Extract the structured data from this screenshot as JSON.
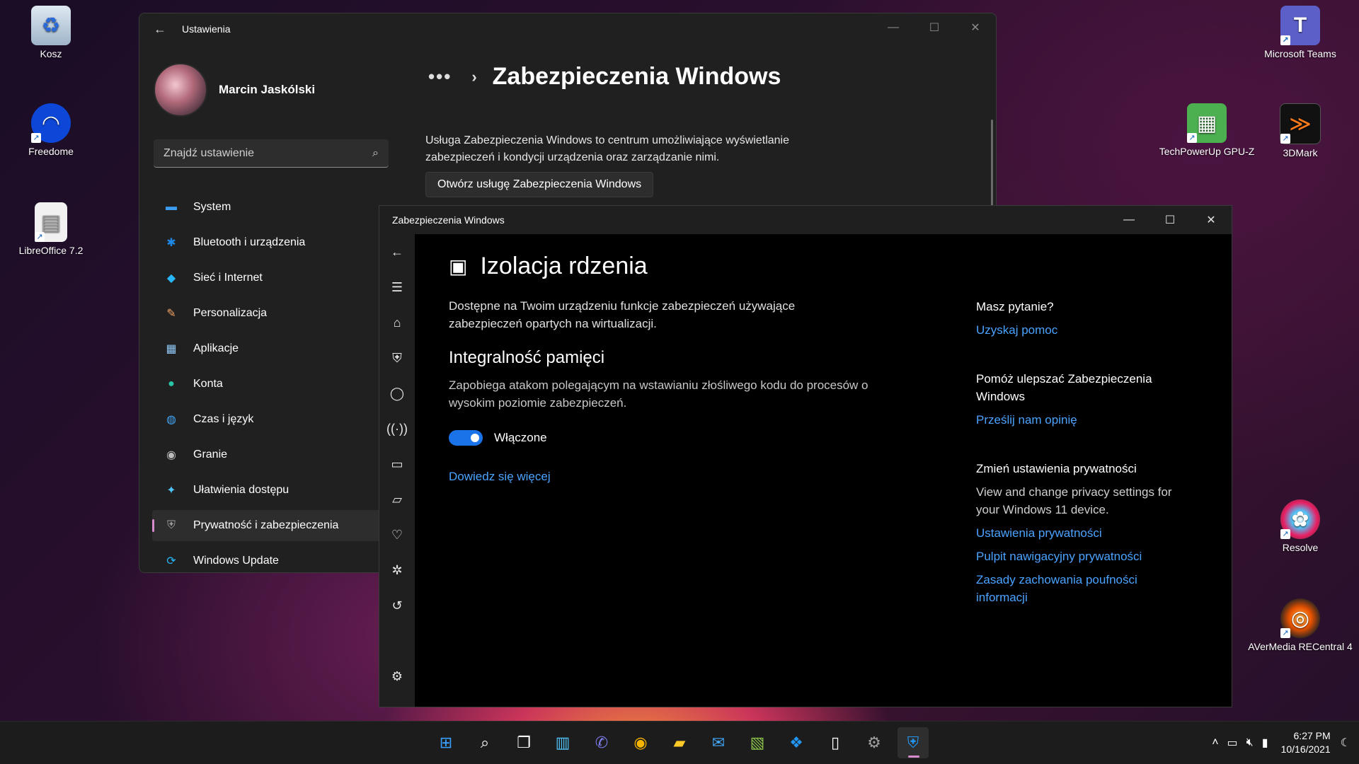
{
  "desktop": {
    "icons": [
      {
        "label": "Kosz",
        "icon": "recycle-bin-icon"
      },
      {
        "label": "Freedome",
        "icon": "freedome-icon"
      },
      {
        "label": "LibreOffice 7.2",
        "icon": "document-icon"
      },
      {
        "label": "Microsoft Teams",
        "icon": "teams-icon"
      },
      {
        "label": "TechPowerUp GPU-Z",
        "icon": "gpu-z-icon"
      },
      {
        "label": "3DMark",
        "icon": "3dmark-icon"
      },
      {
        "label": "Resolve",
        "icon": "resolve-icon"
      },
      {
        "label": "AVerMedia RECentral 4",
        "icon": "recentral-icon"
      }
    ]
  },
  "settings": {
    "title": "Ustawienia",
    "user_name": "Marcin Jaskólski",
    "search_placeholder": "Znajdź ustawienie",
    "nav": [
      {
        "label": "System",
        "icon": "monitor-icon",
        "color": "#3b9cf0"
      },
      {
        "label": "Bluetooth i urządzenia",
        "icon": "bluetooth-icon",
        "color": "#1e88e5"
      },
      {
        "label": "Sieć i Internet",
        "icon": "wifi-icon",
        "color": "#29b6f6"
      },
      {
        "label": "Personalizacja",
        "icon": "brush-icon",
        "color": "#f4a261"
      },
      {
        "label": "Aplikacje",
        "icon": "apps-icon",
        "color": "#90caf9"
      },
      {
        "label": "Konta",
        "icon": "person-icon",
        "color": "#26c6a6"
      },
      {
        "label": "Czas i język",
        "icon": "globe-icon",
        "color": "#42a5f5"
      },
      {
        "label": "Granie",
        "icon": "gamepad-icon",
        "color": "#bdbdbd"
      },
      {
        "label": "Ułatwienia dostępu",
        "icon": "accessibility-icon",
        "color": "#4fc3f7"
      },
      {
        "label": "Prywatność i zabezpieczenia",
        "icon": "shield-icon",
        "color": "#9e9e9e",
        "active": true
      },
      {
        "label": "Windows Update",
        "icon": "update-icon",
        "color": "#29b6f6"
      }
    ],
    "breadcrumb_dots": "•••",
    "page_title": "Zabezpieczenia Windows",
    "description": "Usługa Zabezpieczenia Windows to centrum umożliwiające wyświetlanie zabezpieczeń i kondycji urządzenia oraz zarządzanie nimi.",
    "open_button": "Otwórz usługę Zabezpieczenia Windows"
  },
  "security": {
    "title": "Zabezpieczenia Windows",
    "rail_icons": [
      "back-icon",
      "menu-icon",
      "home-icon",
      "shield-icon",
      "person-icon",
      "wireless-icon",
      "app-browser-icon",
      "laptop-icon",
      "health-icon",
      "family-icon",
      "history-icon",
      "gear-icon"
    ],
    "page_title": "Izolacja rdzenia",
    "page_description": "Dostępne na Twoim urządzeniu funkcje zabezpieczeń używające zabezpieczeń opartych na wirtualizacji.",
    "section_title": "Integralność pamięci",
    "section_description": "Zapobiega atakom polegającym na wstawianiu złośliwego kodu do procesów o wysokim poziomie zabezpieczeń.",
    "toggle_label": "Włączone",
    "toggle_on": true,
    "learn_more": "Dowiedz się więcej",
    "side": {
      "q_title": "Masz pytanie?",
      "q_link": "Uzyskaj pomoc",
      "improve_title": "Pomóż ulepszać Zabezpieczenia Windows",
      "improve_link": "Prześlij nam opinię",
      "privacy_title": "Zmień ustawienia prywatności",
      "privacy_text": "View and change privacy settings for your Windows 11 device.",
      "privacy_links": [
        "Ustawienia prywatności",
        "Pulpit nawigacyjny prywatności",
        "Zasady zachowania poufności informacji"
      ]
    }
  },
  "taskbar": {
    "apps": [
      "start-icon",
      "search-icon",
      "task-view-icon",
      "widgets-icon",
      "chat-icon",
      "chrome-icon",
      "file-explorer-icon",
      "mail-icon",
      "color-app-icon",
      "dropbox-icon",
      "notepad-icon",
      "settings-icon",
      "windows-security-icon"
    ],
    "time": "6:27 PM",
    "date": "10/16/2021"
  }
}
